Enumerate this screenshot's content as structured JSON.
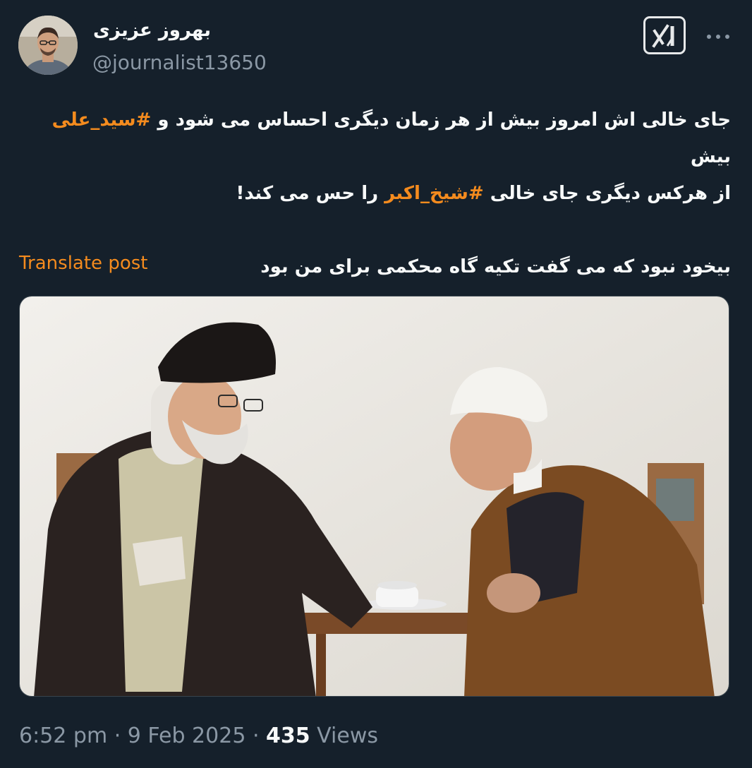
{
  "author": {
    "display_name": "بهروز عزیزی",
    "handle": "@journalist13650",
    "avatar_icon": "profile-photo"
  },
  "header": {
    "grok_icon": "grok-icon",
    "more_icon": "more-icon"
  },
  "post": {
    "line1_start": "جای خالی اش امروز بیش از هر زمان دیگری احساس می شود و ",
    "hashtag1": "#سید_علی",
    "line1_end": " بیش",
    "line2_start": "از هرکس دیگری جای خالی ",
    "hashtag2": "#شیخ_اکبر",
    "line2_end": " را حس می کند!",
    "line3": "بیخود نبود که می گفت تکیه گاه محکمی برای من بود"
  },
  "translate_label": "Translate post",
  "media": {
    "description_icon": "photo-two-clerics"
  },
  "meta": {
    "time": "6:52 pm",
    "sep1": " · ",
    "date": "9 Feb 2025",
    "sep2": " · ",
    "views_count": "435",
    "views_label": " Views"
  },
  "colors": {
    "background": "#15202b",
    "accent": "#f48b1e",
    "secondary_text": "#8b98a5",
    "primary_text": "#f7f9f9"
  }
}
